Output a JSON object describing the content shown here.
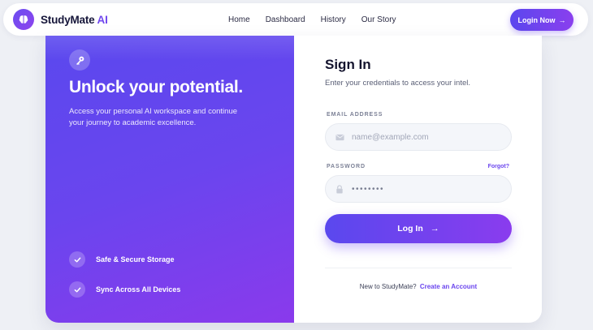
{
  "brand": {
    "name": "StudyMate",
    "accent": "AI",
    "logo_icon": "brain-icon"
  },
  "nav": {
    "links": [
      {
        "label": "Home"
      },
      {
        "label": "Dashboard"
      },
      {
        "label": "History"
      },
      {
        "label": "Our Story"
      }
    ],
    "cta_label": "Login Now",
    "cta_icon": "arrow-right-icon"
  },
  "hero": {
    "icon": "key-icon",
    "headline": "Unlock your potential.",
    "subtext": "Access your personal AI workspace and continue your journey to academic excellence.",
    "features": [
      {
        "label": "Safe & Secure Storage",
        "icon": "check-icon"
      },
      {
        "label": "Sync Across All Devices",
        "icon": "check-icon"
      }
    ]
  },
  "form": {
    "title": "Sign In",
    "subtitle": "Enter your credentials to access your intel.",
    "email_label": "EMAIL ADDRESS",
    "email_placeholder": "name@example.com",
    "email_icon": "mail-icon",
    "password_label": "PASSWORD",
    "password_value": "••••••••",
    "password_icon": "lock-icon",
    "forgot_label": "Forgot?",
    "submit_label": "Log In",
    "signup_prompt": "New to StudyMate?",
    "signup_link": "Create an Account"
  },
  "colors": {
    "primary": "#6a45ee",
    "gradient_start": "#5a48ee",
    "gradient_end": "#8a3cee",
    "text_dark": "#14142e",
    "input_bg": "#f4f6fa"
  }
}
